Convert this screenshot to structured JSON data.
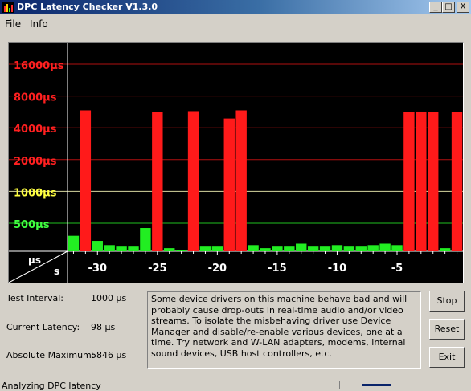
{
  "window": {
    "title": "DPC Latency Checker V1.3.0"
  },
  "title_buttons": {
    "minimize": "_",
    "maximize": "□",
    "close": "X"
  },
  "menu": {
    "file": "File",
    "info": "Info"
  },
  "chart_data": {
    "type": "bar",
    "y_scale": "log2",
    "y_unit": "µs",
    "y_tick_labels": [
      {
        "text": "16000µs",
        "value": 16000,
        "color": "#ff2020"
      },
      {
        "text": "8000µs",
        "value": 8000,
        "color": "#ff2020"
      },
      {
        "text": "4000µs",
        "value": 4000,
        "color": "#ff2020"
      },
      {
        "text": "2000µs",
        "value": 2000,
        "color": "#ff2020"
      },
      {
        "text": "1000µs",
        "value": 1000,
        "color": "#ffff40"
      },
      {
        "text": "500µs",
        "value": 500,
        "color": "#40ff40"
      }
    ],
    "x_tick_labels": [
      "-30",
      "-25",
      "-20",
      "-15",
      "-10",
      "-5"
    ],
    "x_tick_values": [
      -30,
      -25,
      -20,
      -15,
      -10,
      -5
    ],
    "x_range": [
      -32.5,
      0.5
    ],
    "y_range": [
      250,
      24000
    ],
    "axis_corner": {
      "y_unit": "µs",
      "x_unit": "s"
    },
    "x": [
      -32,
      -31,
      -30,
      -29,
      -28,
      -27,
      -26,
      -25,
      -24,
      -23,
      -22,
      -21,
      -20,
      -19,
      -18,
      -17,
      -16,
      -15,
      -14,
      -13,
      -12,
      -11,
      -10,
      -9,
      -8,
      -7,
      -6,
      -5,
      -4,
      -3,
      -2,
      -1,
      0
    ],
    "values": [
      380,
      5850,
      340,
      310,
      300,
      300,
      450,
      5650,
      290,
      280,
      5750,
      300,
      300,
      4900,
      5850,
      310,
      290,
      300,
      300,
      320,
      300,
      300,
      310,
      300,
      300,
      310,
      320,
      310,
      5600,
      5700,
      5650,
      290,
      5600
    ],
    "colors": {
      "ok": "#22ee22",
      "bad": "#ff1a1a",
      "threshold": 1000
    }
  },
  "stats": {
    "test_interval_label": "Test Interval:",
    "test_interval_value": "1000 µs",
    "current_latency_label": "Current Latency:",
    "current_latency_value": "98 µs",
    "absolute_max_label": "Absolute Maximum:",
    "absolute_max_value": "5846 µs"
  },
  "message": "Some device drivers on this machine behave bad and will probably cause drop-outs in real-time audio and/or video streams. To isolate the misbehaving driver use Device Manager and disable/re-enable various devices, one at a time. Try network and W-LAN adapters, modems, internal sound devices, USB host controllers, etc.",
  "buttons": {
    "stop": "Stop",
    "reset": "Reset",
    "exit": "Exit"
  },
  "status": {
    "text": "Analyzing DPC latency"
  }
}
